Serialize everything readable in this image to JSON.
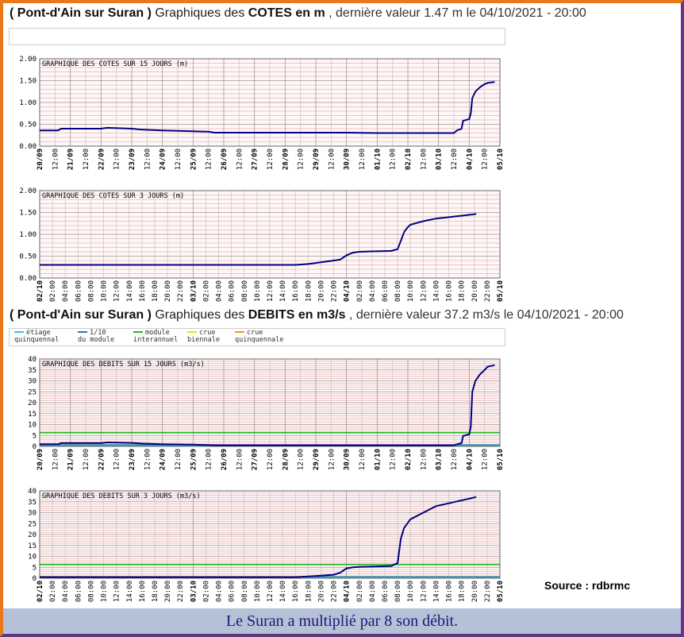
{
  "header1": {
    "station": "( Pont-d'Ain sur Suran )",
    "mid": "Graphiques des",
    "quantity": "COTES en m",
    "rest": ", dernière valeur 1.47 m le 04/10/2021 - 20:00"
  },
  "header2": {
    "station": "( Pont-d'Ain sur Suran )",
    "mid": "Graphiques des",
    "quantity": "DEBITS en m3/s",
    "rest": ", dernière valeur 37.2 m3/s le 04/10/2021 - 20:00"
  },
  "legend": [
    {
      "line1": "étiage",
      "line2": "quinquennal",
      "color": "#2ec4d8"
    },
    {
      "line1": "1/10",
      "line2": "du module",
      "color": "#1f7fb5"
    },
    {
      "line1": "module",
      "line2": "interannuel",
      "color": "#22bb22"
    },
    {
      "line1": "crue",
      "line2": "biennale",
      "color": "#f0e000"
    },
    {
      "line1": "crue",
      "line2": "quinquennale",
      "color": "#e8a000"
    }
  ],
  "source": "Source : rdbrmc",
  "caption": "Le Suran a multiplié par 8 son débit.",
  "colors": {
    "series": "#000080",
    "grid_major": "#999999",
    "grid_minor": "#e8b4b4",
    "plot_bg": "#fff7f7"
  },
  "chart_data": [
    {
      "type": "line",
      "title": "GRAPHIQUE DES COTES SUR 15 JOURS (m)",
      "ylim": [
        0,
        2
      ],
      "yticks": [
        "0.00",
        "0.50",
        "1.00",
        "1.50",
        "2.00"
      ],
      "ytick_values": [
        0,
        0.5,
        1,
        1.5,
        2
      ],
      "minor_per_major": 5,
      "xlim": [
        0,
        15
      ],
      "xticks": [
        "20/09",
        "12:00",
        "21/09",
        "12:00",
        "22/09",
        "12:00",
        "23/09",
        "12:00",
        "24/09",
        "12:00",
        "25/09",
        "12:00",
        "26/09",
        "12:00",
        "27/09",
        "12:00",
        "28/09",
        "12:00",
        "29/09",
        "12:00",
        "30/09",
        "12:00",
        "01/10",
        "12:00",
        "02/10",
        "12:00",
        "03/10",
        "12:00",
        "04/10",
        "12:00",
        "05/10"
      ],
      "series": [
        {
          "x": [
            0,
            0.6,
            0.7,
            2,
            2.2,
            3,
            3.3,
            4,
            5,
            5.5,
            5.7,
            9,
            10,
            11,
            12,
            13,
            13.5,
            13.6,
            13.75,
            13.8,
            14,
            14.05,
            14.1,
            14.2,
            14.35,
            14.5,
            14.6,
            14.83
          ],
          "y": [
            0.36,
            0.36,
            0.4,
            0.4,
            0.42,
            0.4,
            0.38,
            0.36,
            0.34,
            0.33,
            0.31,
            0.31,
            0.31,
            0.3,
            0.3,
            0.3,
            0.3,
            0.36,
            0.4,
            0.58,
            0.62,
            0.75,
            1.1,
            1.25,
            1.35,
            1.42,
            1.45,
            1.47
          ]
        }
      ],
      "thresholds": []
    },
    {
      "type": "line",
      "title": "GRAPHIQUE DES COTES SUR 3 JOURS (m)",
      "ylim": [
        0,
        2
      ],
      "yticks": [
        "0.00",
        "0.50",
        "1.00",
        "1.50",
        "2.00"
      ],
      "ytick_values": [
        0,
        0.5,
        1,
        1.5,
        2
      ],
      "minor_per_major": 5,
      "xlim": [
        0,
        72
      ],
      "xticks": [
        "02/10",
        "02:00",
        "04:00",
        "06:00",
        "08:00",
        "10:00",
        "12:00",
        "14:00",
        "16:00",
        "18:00",
        "20:00",
        "22:00",
        "03/10",
        "02:00",
        "04:00",
        "06:00",
        "08:00",
        "10:00",
        "12:00",
        "14:00",
        "16:00",
        "18:00",
        "20:00",
        "22:00",
        "04/10",
        "02:00",
        "04:00",
        "06:00",
        "08:00",
        "10:00",
        "12:00",
        "14:00",
        "16:00",
        "18:00",
        "20:00",
        "22:00",
        "05/10"
      ],
      "series": [
        {
          "x": [
            0,
            40,
            42,
            44,
            46,
            47,
            48,
            49,
            50,
            52,
            55,
            56,
            56.5,
            57,
            57.5,
            58,
            60,
            62,
            65,
            68,
            68.3
          ],
          "y": [
            0.3,
            0.3,
            0.32,
            0.36,
            0.4,
            0.42,
            0.52,
            0.58,
            0.6,
            0.61,
            0.62,
            0.66,
            0.85,
            1.05,
            1.15,
            1.22,
            1.3,
            1.36,
            1.41,
            1.46,
            1.47
          ]
        }
      ],
      "thresholds": []
    },
    {
      "type": "line",
      "title": "GRAPHIQUE DES DEBITS SUR 15 JOURS (m3/s)",
      "ylim": [
        0,
        40
      ],
      "yticks": [
        "0",
        "5",
        "10",
        "15",
        "20",
        "25",
        "30",
        "35",
        "40"
      ],
      "ytick_values": [
        0,
        5,
        10,
        15,
        20,
        25,
        30,
        35,
        40
      ],
      "minor_per_major": 5,
      "xlim": [
        0,
        15
      ],
      "xticks": [
        "20/09",
        "12:00",
        "21/09",
        "12:00",
        "22/09",
        "12:00",
        "23/09",
        "12:00",
        "24/09",
        "12:00",
        "25/09",
        "12:00",
        "26/09",
        "12:00",
        "27/09",
        "12:00",
        "28/09",
        "12:00",
        "29/09",
        "12:00",
        "30/09",
        "12:00",
        "01/10",
        "12:00",
        "02/10",
        "12:00",
        "03/10",
        "12:00",
        "04/10",
        "12:00",
        "05/10"
      ],
      "series": [
        {
          "x": [
            0,
            0.6,
            0.7,
            2,
            2.2,
            3,
            3.3,
            4,
            5,
            5.5,
            5.7,
            13,
            13.5,
            13.6,
            13.75,
            13.8,
            14,
            14.05,
            14.1,
            14.2,
            14.35,
            14.5,
            14.6,
            14.83
          ],
          "y": [
            1.0,
            1.0,
            1.5,
            1.5,
            1.8,
            1.6,
            1.3,
            1.0,
            0.8,
            0.6,
            0.5,
            0.5,
            0.5,
            1.0,
            1.5,
            4.8,
            5.5,
            9,
            25,
            30,
            33,
            35,
            36.5,
            37.2
          ]
        }
      ],
      "thresholds": [
        {
          "value": 6.3,
          "color": "#22bb22"
        },
        {
          "value": 0.6,
          "color": "#1f7fb5"
        },
        {
          "value": 0.2,
          "color": "#2ec4d8"
        }
      ]
    },
    {
      "type": "line",
      "title": "GRAPHIQUE DES DEBITS SUR 3 JOURS (m3/s)",
      "ylim": [
        0,
        40
      ],
      "yticks": [
        "0",
        "5",
        "10",
        "15",
        "20",
        "25",
        "30",
        "35",
        "40"
      ],
      "ytick_values": [
        0,
        5,
        10,
        15,
        20,
        25,
        30,
        35,
        40
      ],
      "minor_per_major": 5,
      "xlim": [
        0,
        72
      ],
      "xticks": [
        "02/10",
        "02:00",
        "04:00",
        "06:00",
        "08:00",
        "10:00",
        "12:00",
        "14:00",
        "16:00",
        "18:00",
        "20:00",
        "22:00",
        "03/10",
        "02:00",
        "04:00",
        "06:00",
        "08:00",
        "10:00",
        "12:00",
        "14:00",
        "16:00",
        "18:00",
        "20:00",
        "22:00",
        "04/10",
        "02:00",
        "04:00",
        "06:00",
        "08:00",
        "10:00",
        "12:00",
        "14:00",
        "16:00",
        "18:00",
        "20:00",
        "22:00",
        "05/10"
      ],
      "series": [
        {
          "x": [
            0,
            40,
            42,
            44,
            46,
            47,
            48,
            49,
            50,
            52,
            55,
            56,
            56.5,
            57,
            57.5,
            58,
            60,
            62,
            65,
            68,
            68.3
          ],
          "y": [
            0.5,
            0.5,
            0.8,
            1.2,
            1.6,
            2.5,
            4.5,
            5.0,
            5.2,
            5.3,
            5.6,
            7.0,
            18,
            23,
            25,
            27,
            30,
            33,
            35,
            37,
            37.2
          ]
        }
      ],
      "thresholds": [
        {
          "value": 6.3,
          "color": "#22bb22"
        },
        {
          "value": 0.6,
          "color": "#1f7fb5"
        },
        {
          "value": 0.2,
          "color": "#2ec4d8"
        }
      ]
    }
  ]
}
